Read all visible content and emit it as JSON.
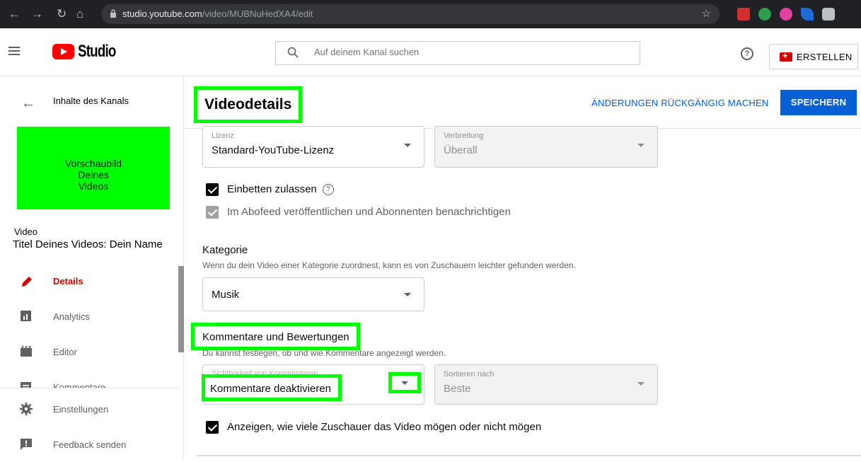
{
  "browser": {
    "url_host": "studio.youtube.com",
    "url_path": "/video/MUBNuHedXA4/edit"
  },
  "topbar": {
    "logo_text": "Studio",
    "search_placeholder": "Auf deinem Kanal suchen",
    "help_icon": "?",
    "create_label": "ERSTELLEN"
  },
  "sidebar": {
    "back_label": "Inhalte des Kanals",
    "thumbnail_lines": [
      "Vorschaubild",
      "Deines",
      "Videos"
    ],
    "video_label": "Video",
    "video_title": "Titel Deines Videos: Dein Name",
    "items": [
      {
        "label": "Details",
        "icon": "pencil-icon",
        "active": true
      },
      {
        "label": "Analytics",
        "icon": "analytics-icon",
        "active": false
      },
      {
        "label": "Editor",
        "icon": "clapperboard-icon",
        "active": false
      },
      {
        "label": "Kommentare",
        "icon": "comment-icon",
        "active": false
      }
    ],
    "footer_items": [
      {
        "label": "Einstellungen",
        "icon": "gear-icon"
      },
      {
        "label": "Feedback senden",
        "icon": "feedback-icon"
      }
    ]
  },
  "header": {
    "title": "Videodetails",
    "undo_label": "ÄNDERUNGEN RÜCKGÄNGIG MACHEN",
    "save_label": "SPEICHERN"
  },
  "main": {
    "license": {
      "caption": "Lizenz",
      "value": "Standard-YouTube-Lizenz"
    },
    "distribution": {
      "caption": "Verbreitung",
      "value": "Überall"
    },
    "embed_label": "Einbetten zulassen",
    "feed_label": "Im Abofeed veröffentlichen und Abonnenten benachrichtigen",
    "category": {
      "heading": "Kategorie",
      "description": "Wenn du dein Video einer Kategorie zuordnest, kann es von Zuschauern leichter gefunden werden.",
      "value": "Musik"
    },
    "comments": {
      "heading": "Kommentare und Bewertungen",
      "description": "Du kannst festlegen, ob und wie Kommentare angezeigt werden.",
      "visibility_caption": "Sichtbarkeit von Kommentaren",
      "visibility_value": "Kommentare deaktivieren",
      "sort_caption": "Sortieren nach",
      "sort_value": "Beste"
    },
    "ratings_label": "Anzeigen, wie viele Zuschauer das Video mögen oder nicht mögen"
  },
  "colors": {
    "highlight": "#00ff00",
    "accent_blue": "#065fd4",
    "brand_red": "#ff0000"
  }
}
